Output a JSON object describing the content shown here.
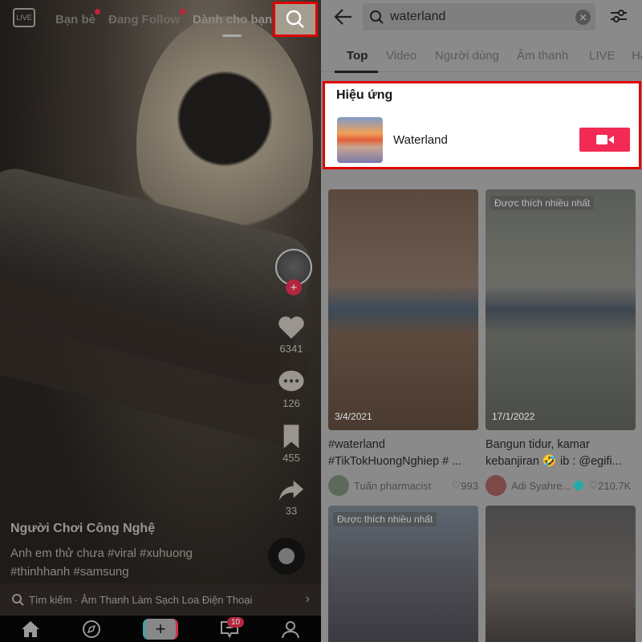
{
  "left": {
    "live_label": "LIVE",
    "tabs": [
      {
        "label": "Bạn bè",
        "dot": true
      },
      {
        "label": "Đang Follow",
        "dot": true
      },
      {
        "label": "Dành cho bạn",
        "active": true
      }
    ],
    "actions": {
      "likes": "6341",
      "comments": "126",
      "saves": "455",
      "shares": "33"
    },
    "author": "Người Chơi Công Nghệ",
    "description": "Anh em thử chưa #viral #xuhuong #thinhhanh #samsung",
    "search_bar": "Tìm kiếm · Âm Thanh Làm Sạch Loa Điện Thoại",
    "inbox_badge": "10"
  },
  "right": {
    "search_value": "waterland",
    "tabs": [
      "Top",
      "Video",
      "Người dùng",
      "Âm thanh",
      "LIVE",
      "Ha"
    ],
    "active_tab": "Top",
    "effects": {
      "heading": "Hiệu ứng",
      "name": "Waterland"
    },
    "results": [
      {
        "label": "",
        "date": "3/4/2021",
        "title": "#waterland #TikTokHuongNghiep # ...",
        "author": "Tuấn pharmacist",
        "likes": "993",
        "verified": false
      },
      {
        "label": "Được thích nhiều nhất",
        "date": "17/1/2022",
        "title": "Bangun tidur, kamar kebanjiran 🤣 ib : @egifi...",
        "author": "Adi Syahre...",
        "likes": "210.7K",
        "verified": true
      },
      {
        "label": "Được thích nhiều nhất"
      },
      {
        "label": ""
      }
    ]
  },
  "colors": {
    "highlight": "#e00000",
    "accent": "#f22a55"
  }
}
